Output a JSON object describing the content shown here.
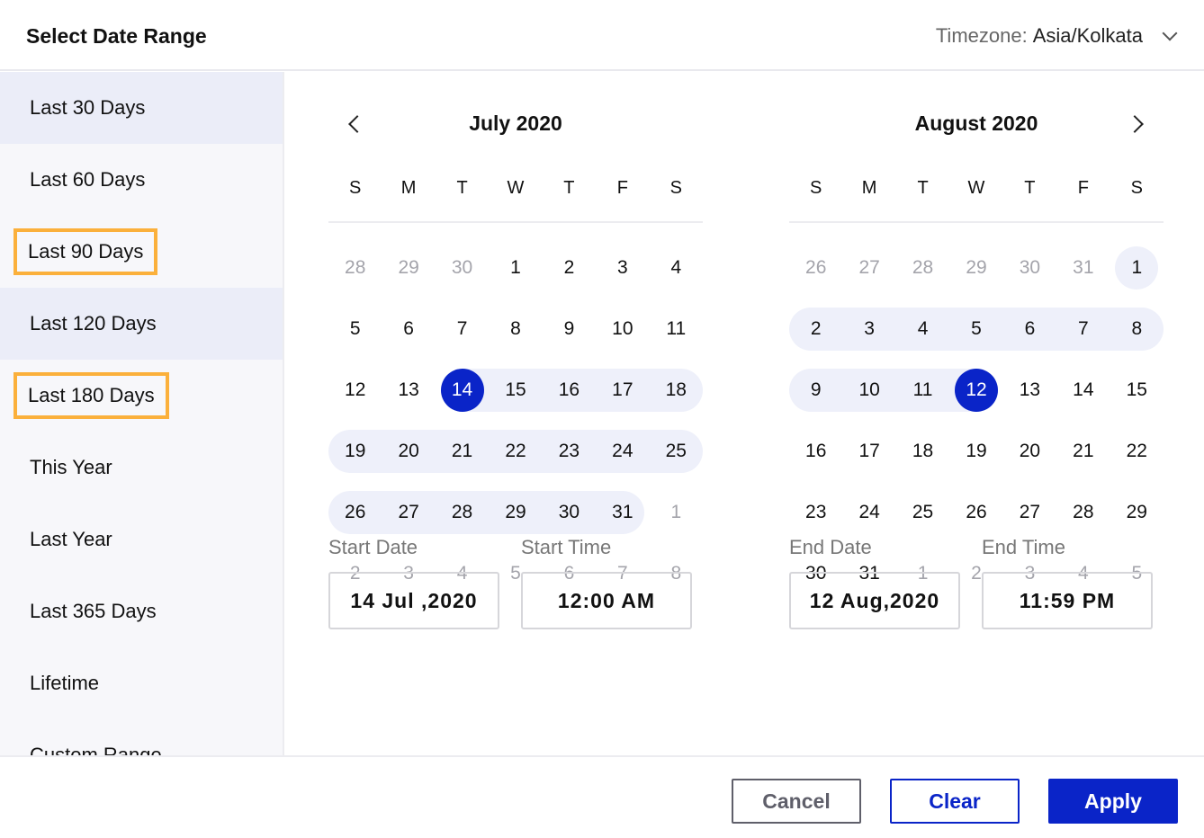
{
  "header": {
    "title": "Select Date Range",
    "timezone_label": "Timezone:",
    "timezone_value": "Asia/Kolkata"
  },
  "sidebar": {
    "items": [
      {
        "label": "Last 30 Days",
        "selected": true,
        "highlighted": false
      },
      {
        "label": "Last 60 Days",
        "selected": false,
        "highlighted": false
      },
      {
        "label": "Last 90 Days",
        "selected": false,
        "highlighted": true
      },
      {
        "label": "Last 120 Days",
        "selected": true,
        "highlighted": false
      },
      {
        "label": "Last 180 Days",
        "selected": false,
        "highlighted": true
      },
      {
        "label": "This Year",
        "selected": false,
        "highlighted": false
      },
      {
        "label": "Last Year",
        "selected": false,
        "highlighted": false
      },
      {
        "label": "Last 365 Days",
        "selected": false,
        "highlighted": false
      },
      {
        "label": "Lifetime",
        "selected": false,
        "highlighted": false
      },
      {
        "label": "Custom Range",
        "selected": false,
        "highlighted": false
      }
    ]
  },
  "weekdays": [
    "S",
    "M",
    "T",
    "W",
    "T",
    "F",
    "S"
  ],
  "months": [
    {
      "title": "July 2020",
      "weeks": [
        [
          28,
          29,
          30,
          1,
          2,
          3,
          4
        ],
        [
          5,
          6,
          7,
          8,
          9,
          10,
          11
        ],
        [
          12,
          13,
          14,
          15,
          16,
          17,
          18
        ],
        [
          19,
          20,
          21,
          22,
          23,
          24,
          25
        ],
        [
          26,
          27,
          28,
          29,
          30,
          31,
          1
        ],
        [
          2,
          3,
          4,
          5,
          6,
          7,
          8
        ]
      ],
      "first_in_month": [
        0,
        3
      ],
      "last_in_month": [
        4,
        5
      ],
      "range_from": 14,
      "range_to": 31,
      "endpoint": 14
    },
    {
      "title": "August 2020",
      "weeks": [
        [
          26,
          27,
          28,
          29,
          30,
          31,
          1
        ],
        [
          2,
          3,
          4,
          5,
          6,
          7,
          8
        ],
        [
          9,
          10,
          11,
          12,
          13,
          14,
          15
        ],
        [
          16,
          17,
          18,
          19,
          20,
          21,
          22
        ],
        [
          23,
          24,
          25,
          26,
          27,
          28,
          29
        ],
        [
          30,
          31,
          1,
          2,
          3,
          4,
          5
        ]
      ],
      "first_in_month": [
        0,
        6
      ],
      "last_in_month": [
        5,
        1
      ],
      "range_from": 1,
      "range_to": 12,
      "endpoint": 12
    }
  ],
  "fields": {
    "start_date_label": "Start Date",
    "start_date": "14 Jul ,2020",
    "start_time_label": "Start Time",
    "start_time": "12:00 AM",
    "end_date_label": "End Date",
    "end_date": "12 Aug,2020",
    "end_time_label": "End Time",
    "end_time": "11:59 PM"
  },
  "footer": {
    "cancel": "Cancel",
    "clear": "Clear",
    "apply": "Apply"
  },
  "colors": {
    "accent": "#0a24c8",
    "range": "#eef0fa",
    "highlight": "#fbb03b",
    "sidebar_selected": "#ebedf8"
  }
}
